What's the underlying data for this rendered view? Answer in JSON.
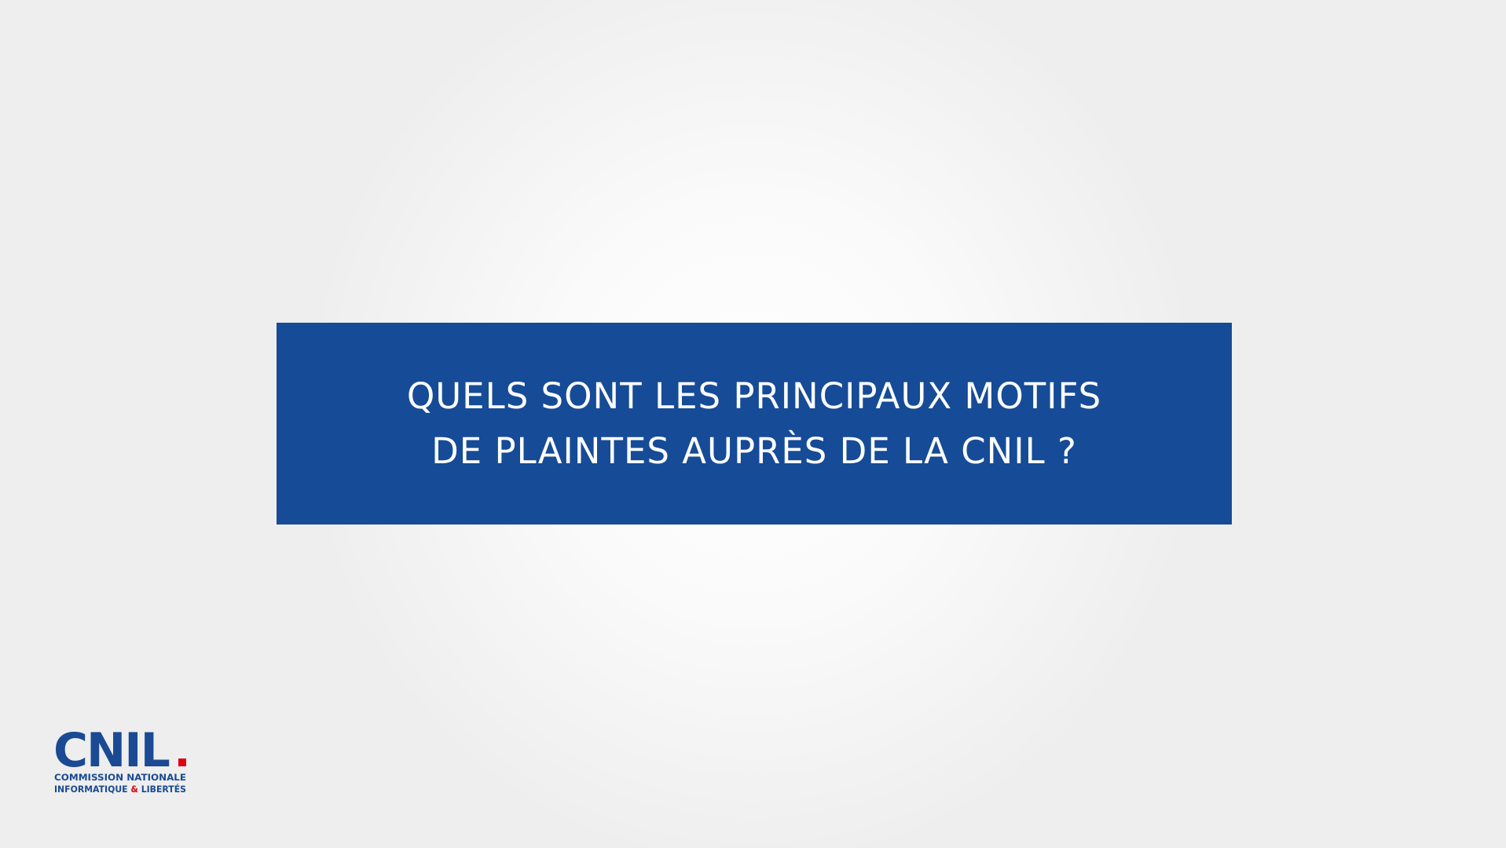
{
  "title": {
    "line1": "QUELS SONT LES PRINCIPAUX MOTIFS",
    "line2": "DE PLAINTES AUPRÈS DE LA CNIL ?"
  },
  "logo": {
    "name": "CNIL",
    "dot": ".",
    "line1": "COMMISSION NATIONALE",
    "line2_part1": "INFORMATIQUE ",
    "line2_amp": "&",
    "line2_part2": " LIBERTÉS"
  },
  "colors": {
    "banner_blue": "#164b97",
    "logo_blue": "#1a4a93",
    "logo_red": "#e1000f",
    "title_text": "#ffffff"
  }
}
